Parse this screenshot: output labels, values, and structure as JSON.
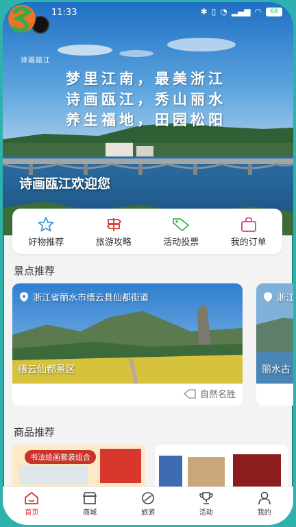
{
  "status": {
    "time": "11:33",
    "battery": "68"
  },
  "hero": {
    "logo_text": "诗画瓯江",
    "slogan_lines": [
      "梦里江南，最美浙江",
      "诗画瓯江，秀山丽水",
      "养生福地，田园松阳"
    ],
    "welcome": "诗画瓯江欢迎您"
  },
  "quick": [
    {
      "label": "好物推荐",
      "icon": "star-icon",
      "color": "#3a9ad9"
    },
    {
      "label": "旅游攻略",
      "icon": "signpost-icon",
      "color": "#d9342b"
    },
    {
      "label": "活动投票",
      "icon": "tag-icon",
      "color": "#3bb54a"
    },
    {
      "label": "我的订单",
      "icon": "bag-icon",
      "color": "#d63c8a"
    }
  ],
  "sections": {
    "spots": "景点推荐",
    "goods": "商品推荐"
  },
  "spots": [
    {
      "location": "浙江省丽水市缙云县仙都街道",
      "name": "缙云仙都景区",
      "tag": "自然名胜"
    },
    {
      "location": "浙江",
      "name": "丽水古"
    }
  ],
  "goods": {
    "banner_text": "书法绘画套装组合"
  },
  "nav": [
    {
      "label": "首页",
      "icon": "home-icon",
      "active": true
    },
    {
      "label": "商城",
      "icon": "shop-icon",
      "active": false
    },
    {
      "label": "旅游",
      "icon": "travel-icon",
      "active": false
    },
    {
      "label": "活动",
      "icon": "trophy-icon",
      "active": false
    },
    {
      "label": "我的",
      "icon": "user-icon",
      "active": false
    }
  ]
}
